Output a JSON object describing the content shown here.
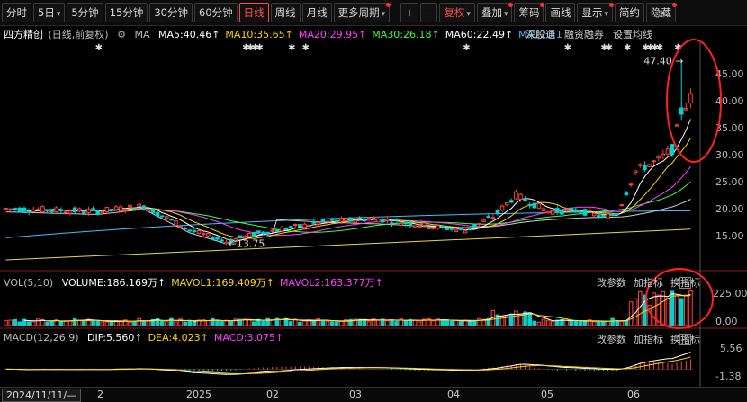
{
  "toolbar": {
    "items": [
      {
        "label": "分时"
      },
      {
        "label": "5日",
        "dropdown": true
      },
      {
        "label": "5分钟"
      },
      {
        "label": "15分钟"
      },
      {
        "label": "30分钟"
      },
      {
        "label": "60分钟"
      },
      {
        "label": "日线",
        "active": true
      },
      {
        "label": "周线"
      },
      {
        "label": "月线"
      },
      {
        "label": "更多周期",
        "dropdown": true,
        "dot": true
      }
    ],
    "right": [
      {
        "label": "+"
      },
      {
        "label": "−"
      },
      {
        "label": "复权",
        "dropdown": true,
        "red": true
      },
      {
        "label": "叠加",
        "dropdown": true,
        "dot": true
      },
      {
        "label": "筹码",
        "dot": true
      },
      {
        "label": "画线"
      },
      {
        "label": "显示",
        "dropdown": true,
        "dot": true
      },
      {
        "label": "简约"
      },
      {
        "label": "隐藏",
        "dot": true
      }
    ]
  },
  "legend": {
    "stock_name": "四方精创",
    "mode": "(日线,前复权)",
    "settings_icon": "gear-icon",
    "ma_label": "MA",
    "items": [
      {
        "text": "MA5:40.46↑",
        "color": "#ffffff"
      },
      {
        "text": "MA10:35.65↑",
        "color": "#ffd700"
      },
      {
        "text": "MA20:29.95↑",
        "color": "#ff40ff"
      },
      {
        "text": "MA30:26.18↑",
        "color": "#40ff40"
      },
      {
        "text": "MA60:22.49↑",
        "color": "#ffffff"
      },
      {
        "text": "MA120:1",
        "color": "#40c0ff"
      }
    ],
    "links": [
      "深股通",
      "融资融券",
      "设置均线"
    ]
  },
  "price_axis": {
    "ticks": [
      "45.00",
      "40.00",
      "35.00",
      "30.00",
      "25.00",
      "20.00",
      "15.00"
    ],
    "values": [
      45,
      40,
      35,
      30,
      25,
      20,
      15
    ]
  },
  "annotations": {
    "high_label": "47.40",
    "low_label": "←13.75",
    "high": 47.4,
    "low": 13.75
  },
  "volume_panel": {
    "title": "VOL(5,10)",
    "items": [
      {
        "text": "VOLUME:186.169万↑",
        "color": "#ffffff"
      },
      {
        "text": "MAVOL1:169.409万↑",
        "color": "#ffd700"
      },
      {
        "text": "MAVOL2:163.377万↑",
        "color": "#ff40ff"
      }
    ],
    "actions": [
      "改参数",
      "加指标",
      "换指标"
    ],
    "ticks": [
      "225.00",
      "0.00"
    ]
  },
  "macd_panel": {
    "title": "MACD(12,26,9)",
    "items": [
      {
        "text": "DIF:5.560↑",
        "color": "#ffffff"
      },
      {
        "text": "DEA:4.023↑",
        "color": "#ffd700"
      },
      {
        "text": "MACD:3.075↑",
        "color": "#ff40ff"
      }
    ],
    "actions": [
      "改参数",
      "加指标",
      "换指标"
    ],
    "ticks": [
      "5.56",
      "-1.38"
    ]
  },
  "date_axis": {
    "selected": "2024/11/11/—",
    "labels": [
      "2",
      "2025",
      "02",
      "03",
      "04",
      "05",
      "06"
    ]
  },
  "colors": {
    "up": "#ff4040",
    "down": "#00d2d2",
    "ma5": "#ffffff",
    "ma10": "#ffd700",
    "ma20": "#ff40ff",
    "ma30": "#40ff40",
    "ma60": "#cfcfcf",
    "ma120": "#40c0ff",
    "annotation": "#ff2020"
  }
}
